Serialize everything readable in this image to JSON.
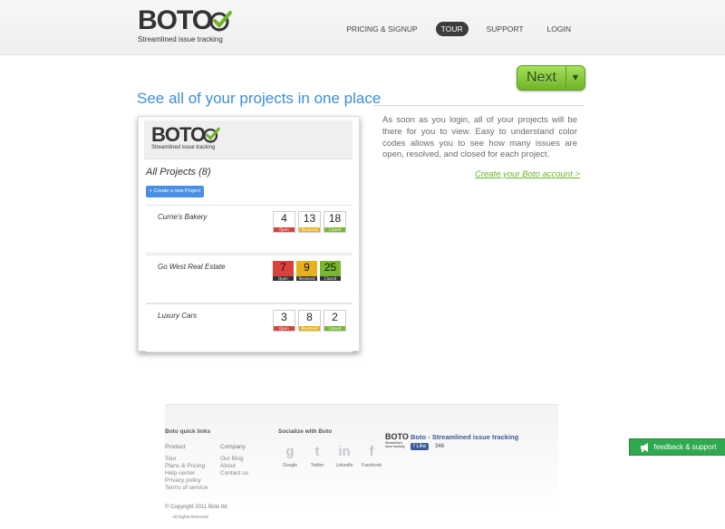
{
  "header": {
    "logo_text": "BOTO",
    "logo_tagline": "Streamlined issue tracking",
    "nav": [
      {
        "label": "PRICING & SIGNUP",
        "active": false
      },
      {
        "label": "TOUR",
        "active": true
      },
      {
        "label": "SUPPORT",
        "active": false
      },
      {
        "label": "LOGIN",
        "active": false
      }
    ]
  },
  "tour": {
    "next_label": "Next",
    "headline": "See all of your projects in one place",
    "description": "As soon as you login, all of your projects will be there for you to view. Easy to understand color codes allows you to see how many issues are open, resolved, and closed for each project.",
    "cta": "Create your Boto account >"
  },
  "preview": {
    "logo_text": "BOTO",
    "logo_tagline": "Streamlined issue tracking",
    "all_projects": "All Projects (8)",
    "create_button": "+ Create a new Project",
    "projects": [
      {
        "name": "Currie's Bakery",
        "open": "4",
        "resolved": "13",
        "closed": "18",
        "filled": false
      },
      {
        "name": "Go West Real Estate",
        "open": "7",
        "resolved": "9",
        "closed": "25",
        "filled": true
      },
      {
        "name": "Luxury Cars",
        "open": "3",
        "resolved": "8",
        "closed": "2",
        "filled": false
      }
    ],
    "labels": {
      "open": "Open",
      "resolved": "Resolved",
      "closed": "Closed"
    },
    "colors": {
      "open": "#d9413b",
      "resolved": "#e8b11b",
      "closed": "#7ab730"
    }
  },
  "footer": {
    "quick_links_title": "Boto quick links",
    "product_head": "Product",
    "product_links": [
      "Tour",
      "Plans & Pricing",
      "Help center",
      "Privacy policy",
      "Terms of service"
    ],
    "company_head": "Company",
    "company_links": [
      "Our Blog",
      "About",
      "Contact us"
    ],
    "social_title": "Socialize with Boto",
    "social": [
      {
        "label": "Google",
        "icon": "google-icon",
        "glyph": "g"
      },
      {
        "label": "Twitter",
        "icon": "twitter-icon",
        "glyph": "t"
      },
      {
        "label": "LinkedIn",
        "icon": "linkedin-icon",
        "glyph": "in"
      },
      {
        "label": "Facebook",
        "icon": "facebook-icon",
        "glyph": "f"
      }
    ],
    "fb_logo_text": "BOTO",
    "fb_logo_tagline": "Streamlined issue tracking",
    "fb_title": "Boto - Streamlined issue tracking",
    "fb_like": "Like",
    "fb_count": "346",
    "copyright": "© Copyright 2011 Boto ltd.",
    "rights": "All Rights Reserved."
  },
  "feedback": {
    "label": "feedback & support",
    "icon": "megaphone-icon"
  }
}
